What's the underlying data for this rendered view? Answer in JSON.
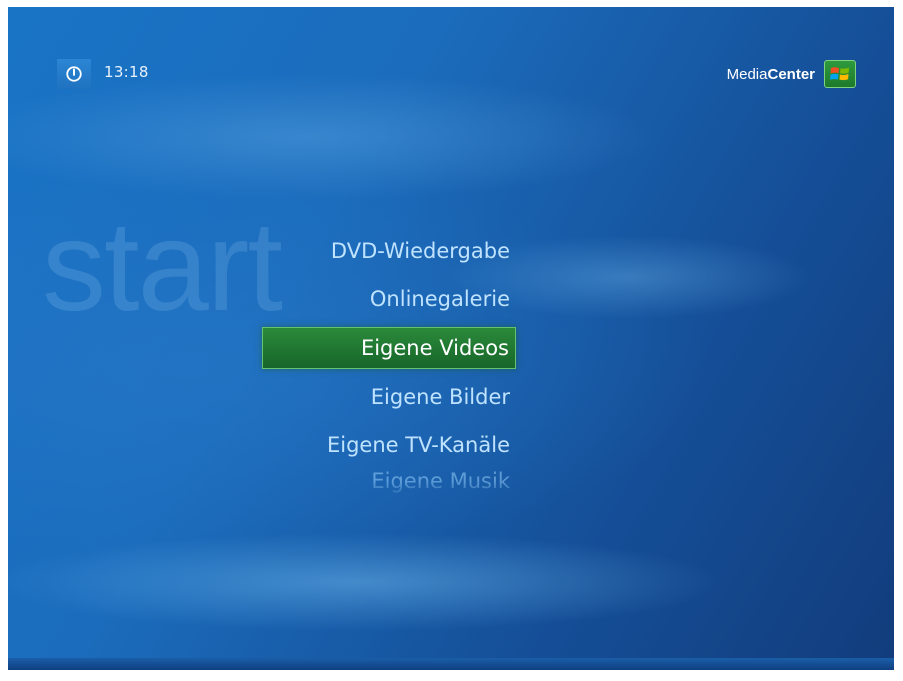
{
  "header": {
    "clock": "13:18",
    "brand_part1": "Media",
    "brand_part2": "Center"
  },
  "watermark": "start",
  "menu": {
    "items": [
      {
        "label": "DVD-Wiedergabe"
      },
      {
        "label": "Onlinegalerie"
      },
      {
        "label": "Eigene Videos",
        "selected": true
      },
      {
        "label": "Eigene Bilder"
      },
      {
        "label": "Eigene TV-Kanäle"
      },
      {
        "label": "Eigene Musik",
        "faded": true
      }
    ]
  },
  "icons": {
    "power": "power-icon",
    "logo": "windows-flag-icon"
  },
  "colors": {
    "background": "#1b6cbc",
    "menu_text": "#bfe3ff",
    "selection": "#2b8a3a"
  }
}
